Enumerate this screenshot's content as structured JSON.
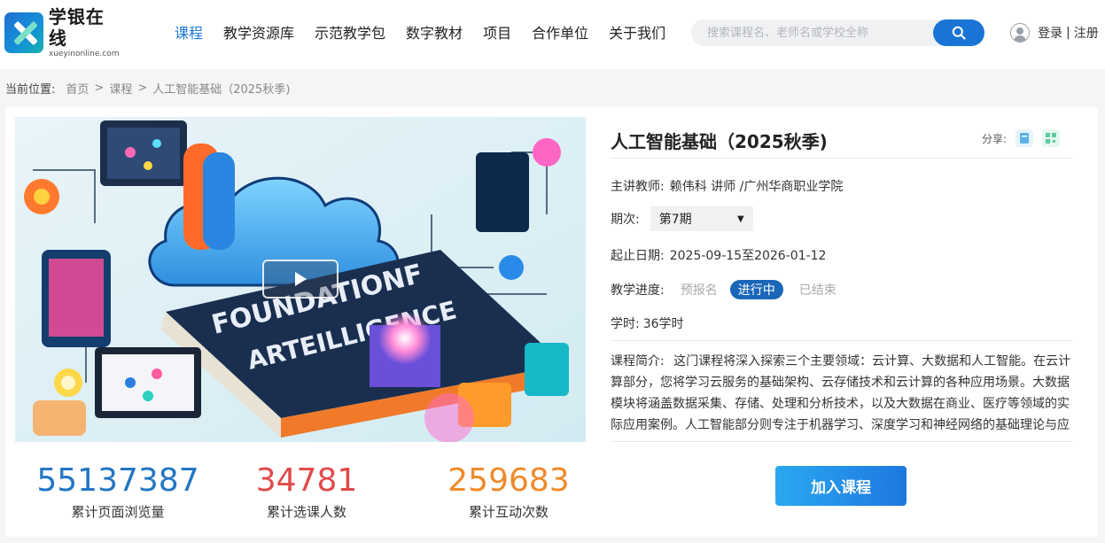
{
  "brand": {
    "name": "学银在线",
    "domain": "xueyinonline.com"
  },
  "nav": [
    {
      "label": "课程",
      "active": true
    },
    {
      "label": "教学资源库"
    },
    {
      "label": "示范教学包"
    },
    {
      "label": "数字教材"
    },
    {
      "label": "项目"
    },
    {
      "label": "合作单位"
    },
    {
      "label": "关于我们"
    }
  ],
  "search": {
    "placeholder": "搜索课程名、老师名或学校全称",
    "value": "",
    "icon": "search-icon"
  },
  "user": {
    "login": "登录",
    "separator": "|",
    "register": "注册",
    "icon": "user-avatar-icon"
  },
  "breadcrumb": {
    "lead": "当前位置:",
    "items": [
      "首页",
      "课程",
      "人工智能基础（2025秋季)"
    ],
    "separator": ">"
  },
  "cover": {
    "art_text_line1": "FOUNDATIONF",
    "art_text_line2": "ARTEILLIGENCE",
    "play_icon": "play-icon"
  },
  "stats": [
    {
      "value": "55137387",
      "label": "累计页面浏览量",
      "color": "#2276c4"
    },
    {
      "value": "34781",
      "label": "累计选课人数",
      "color": "#e24a4a"
    },
    {
      "value": "259683",
      "label": "累计互动次数",
      "color": "#f08a2a"
    }
  ],
  "course": {
    "title": "人工智能基础（2025秋季)",
    "share_label": "分享:",
    "teacher_label": "主讲教师:",
    "teacher": "赖伟科 讲师 /广州华商职业学院",
    "term_label": "期次:",
    "term": "第7期",
    "dates_label": "起止日期:",
    "dates": "2025-09-15至2026-01-12",
    "progress_label": "教学进度:",
    "progress_steps": [
      "预报名",
      "进行中",
      "已结束"
    ],
    "progress_active": 1,
    "hours_label": "学时:",
    "hours": "36学时",
    "intro_label": "课程简介:",
    "intro": "这门课程将深入探索三个主要领域：云计算、大数据和人工智能。在云计算部分，您将学习云服务的基础架构、云存储技术和云计算的各种应用场景。大数据模块将涵盖数据采集、存储、处理和分析技术，以及大数据在商业、医疗等领域的实际应用案例。人工智能部分则专注于机器学习、深度学习和神经网络的基础理论与应用，探…",
    "join_label": "加入课程"
  }
}
